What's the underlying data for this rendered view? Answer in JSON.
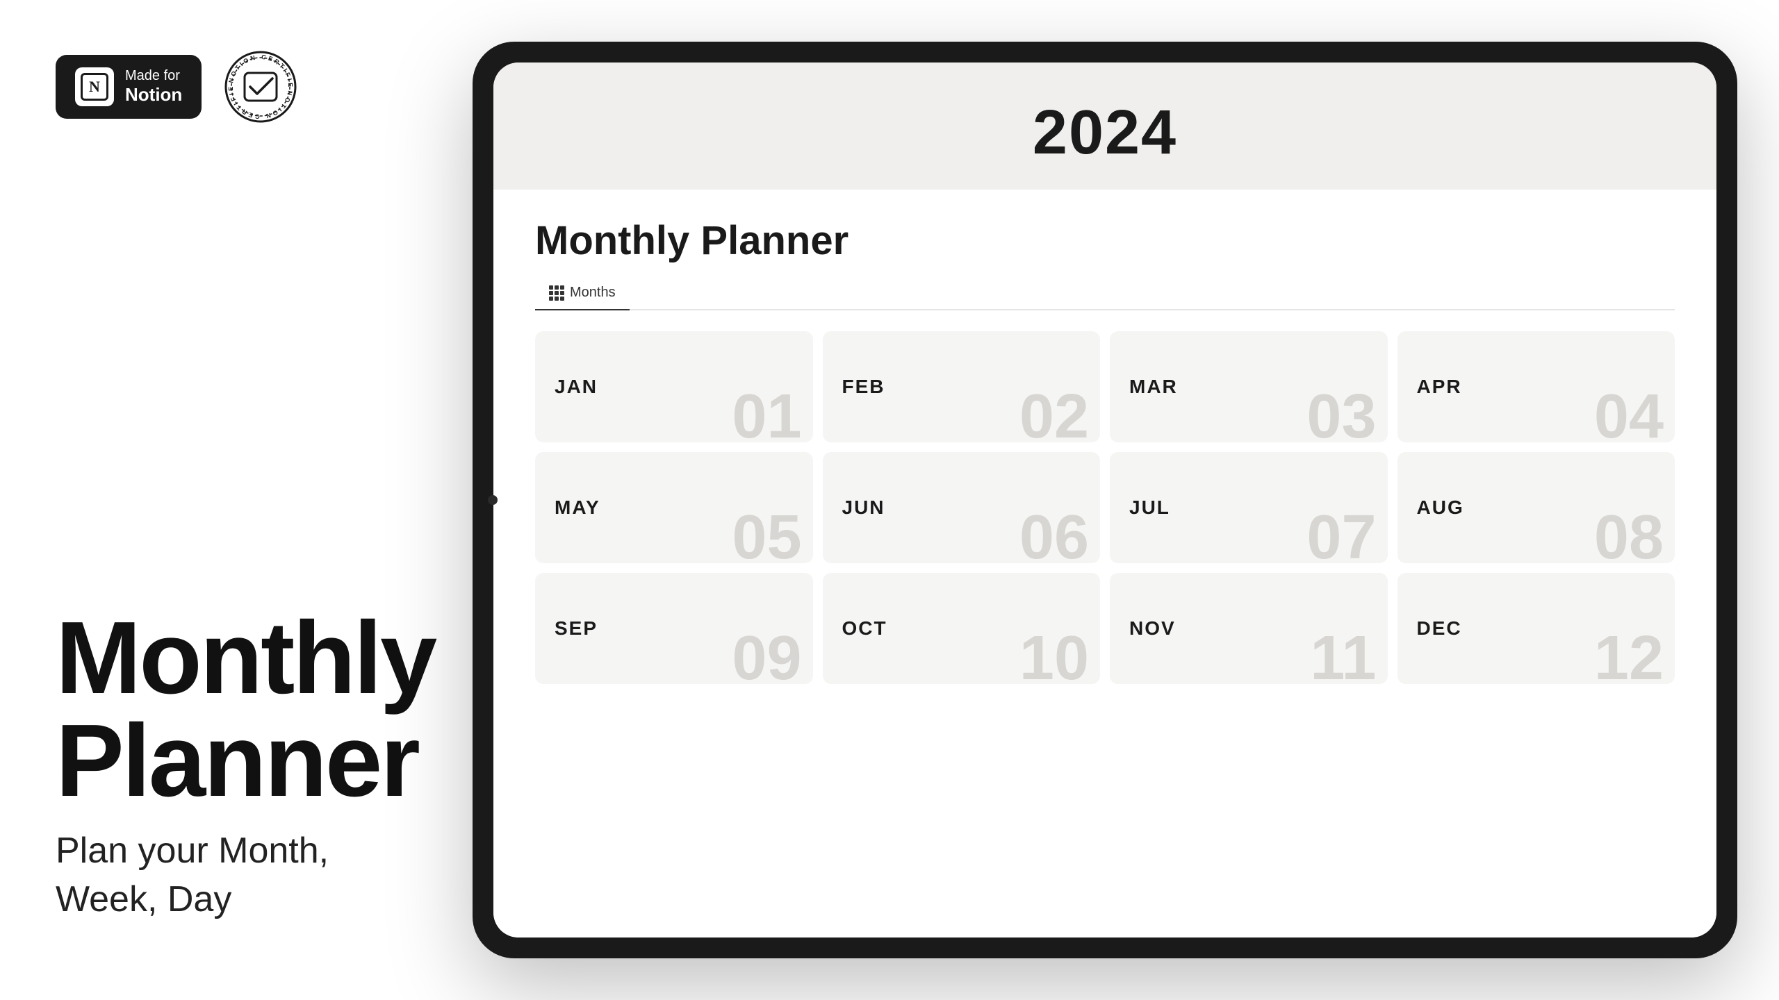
{
  "left": {
    "badge": {
      "made_for": "Made for",
      "notion": "Notion"
    },
    "certified_text": "NOTION CERTIFIED",
    "title_line1": "Monthly",
    "title_line2": "Planner",
    "subtitle": "Plan your Month,\nWeek, Day"
  },
  "tablet": {
    "year": "2024",
    "planner_title": "Monthly Planner",
    "tab_label": "Months",
    "months": [
      {
        "name": "JAN",
        "num": "01"
      },
      {
        "name": "FEB",
        "num": "02"
      },
      {
        "name": "MAR",
        "num": "03"
      },
      {
        "name": "APR",
        "num": "04"
      },
      {
        "name": "MAY",
        "num": "05"
      },
      {
        "name": "JUN",
        "num": "06"
      },
      {
        "name": "JUL",
        "num": "07"
      },
      {
        "name": "AUG",
        "num": "08"
      },
      {
        "name": "SEP",
        "num": "09"
      },
      {
        "name": "OCT",
        "num": "10"
      },
      {
        "name": "NOV",
        "num": "11"
      },
      {
        "name": "DEC",
        "num": "12"
      }
    ]
  }
}
